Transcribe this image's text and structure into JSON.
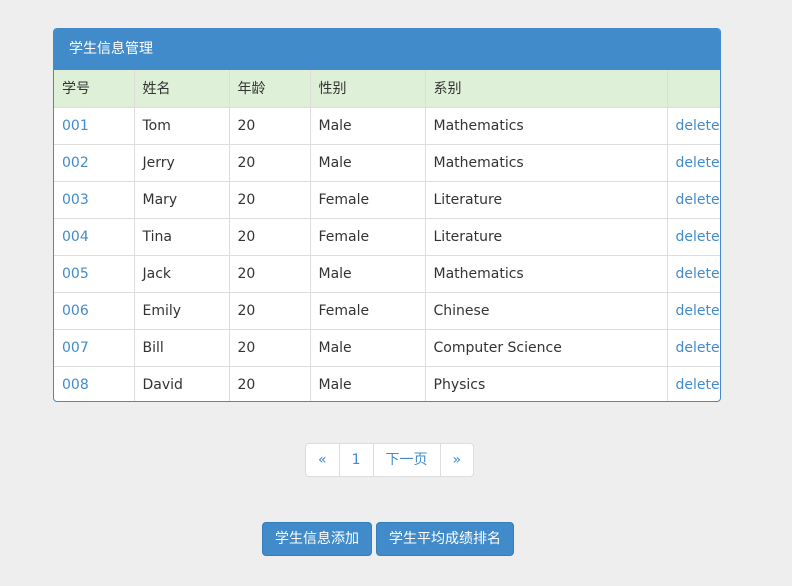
{
  "panel": {
    "title": "学生信息管理"
  },
  "table": {
    "headers": [
      "学号",
      "姓名",
      "年龄",
      "性别",
      "系别",
      ""
    ],
    "rows": [
      {
        "id": "001",
        "name": "Tom",
        "age": "20",
        "gender": "Male",
        "dept": "Mathematics",
        "action": "delete"
      },
      {
        "id": "002",
        "name": "Jerry",
        "age": "20",
        "gender": "Male",
        "dept": "Mathematics",
        "action": "delete"
      },
      {
        "id": "003",
        "name": "Mary",
        "age": "20",
        "gender": "Female",
        "dept": "Literature",
        "action": "delete"
      },
      {
        "id": "004",
        "name": "Tina",
        "age": "20",
        "gender": "Female",
        "dept": "Literature",
        "action": "delete"
      },
      {
        "id": "005",
        "name": "Jack",
        "age": "20",
        "gender": "Male",
        "dept": "Mathematics",
        "action": "delete"
      },
      {
        "id": "006",
        "name": "Emily",
        "age": "20",
        "gender": "Female",
        "dept": "Chinese",
        "action": "delete"
      },
      {
        "id": "007",
        "name": "Bill",
        "age": "20",
        "gender": "Male",
        "dept": "Computer Science",
        "action": "delete"
      },
      {
        "id": "008",
        "name": "David",
        "age": "20",
        "gender": "Male",
        "dept": "Physics",
        "action": "delete"
      }
    ]
  },
  "pagination": {
    "prev": "«",
    "page": "1",
    "next_label": "下一页",
    "last": "»"
  },
  "actions": {
    "add_label": "学生信息添加",
    "rank_label": "学生平均成绩排名"
  },
  "colors": {
    "primary": "#428bca",
    "header_row": "#dff0d8",
    "background": "#eeeeee"
  }
}
